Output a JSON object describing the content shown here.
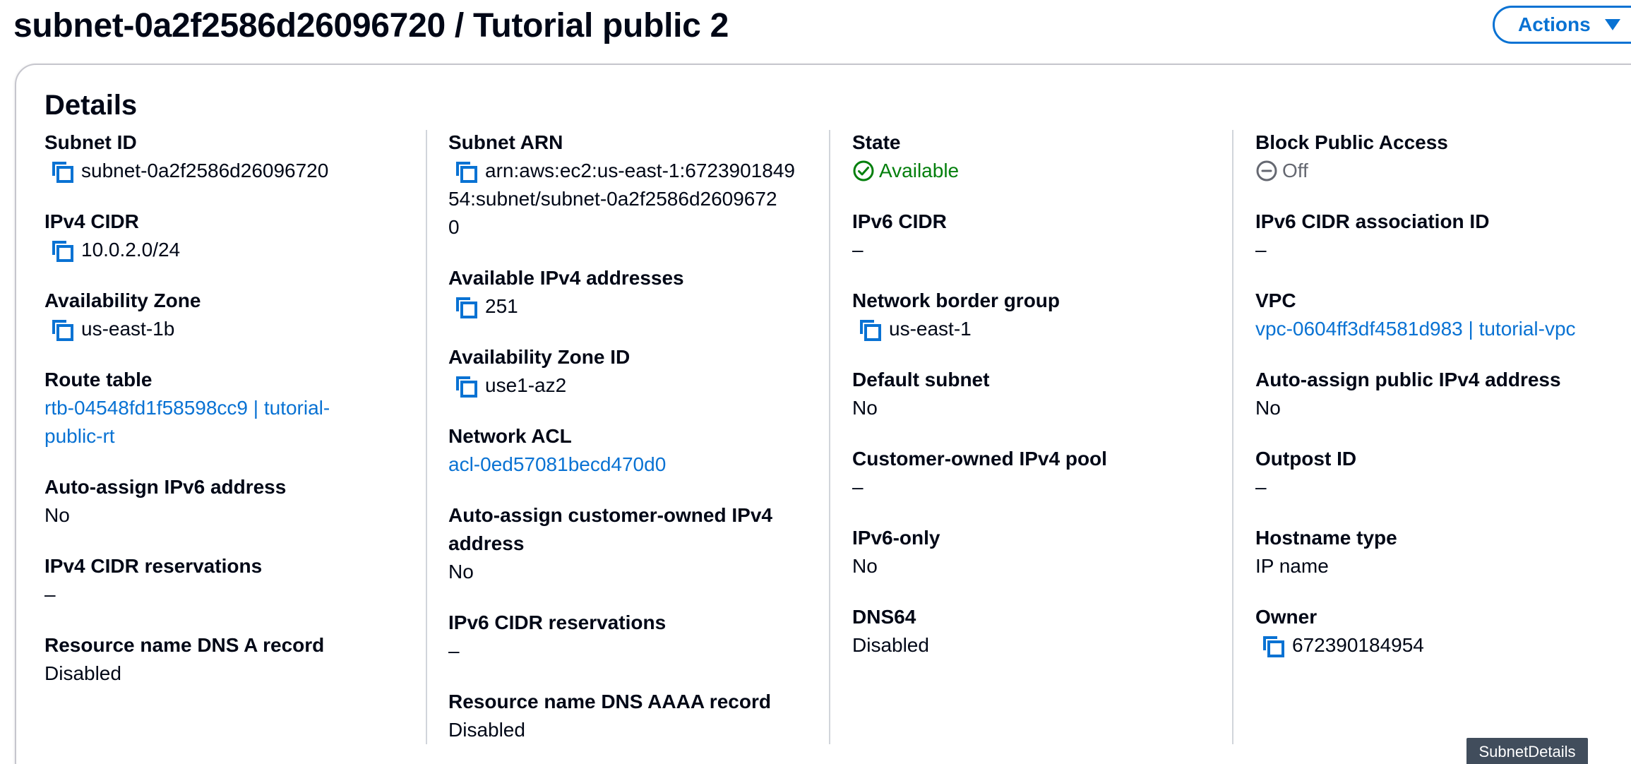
{
  "header": {
    "title": "subnet-0a2f2586d26096720 / Tutorial public 2",
    "actions_label": "Actions"
  },
  "details": {
    "heading": "Details",
    "col1": {
      "subnet_id_label": "Subnet ID",
      "subnet_id_value": "subnet-0a2f2586d26096720",
      "ipv4_cidr_label": "IPv4 CIDR",
      "ipv4_cidr_value": "10.0.2.0/24",
      "az_label": "Availability Zone",
      "az_value": "us-east-1b",
      "route_table_label": "Route table",
      "route_table_line1": "rtb-04548fd1f58598cc9 | tutorial-",
      "route_table_line2": "public-rt",
      "auto_ipv6_label": "Auto-assign IPv6 address",
      "auto_ipv6_value": "No",
      "ipv4_res_label": "IPv4 CIDR reservations",
      "ipv4_res_value": "–",
      "dns_a_label": "Resource name DNS A record",
      "dns_a_value": "Disabled"
    },
    "col2": {
      "arn_label": "Subnet ARN",
      "arn_line1": "arn:aws:ec2:us-east-1:6723901849",
      "arn_line2": "54:subnet/subnet-0a2f2586d2609672",
      "arn_line3": "0",
      "avail_ipv4_label": "Available IPv4 addresses",
      "avail_ipv4_value": "251",
      "az_id_label": "Availability Zone ID",
      "az_id_value": "use1-az2",
      "nacl_label": "Network ACL",
      "nacl_value": "acl-0ed57081becd470d0",
      "auto_cust_label_line1": "Auto-assign customer-owned IPv4",
      "auto_cust_label_line2": "address",
      "auto_cust_value": "No",
      "ipv6_res_label": "IPv6 CIDR reservations",
      "ipv6_res_value": "–",
      "dns_aaaa_label": "Resource name DNS AAAA record",
      "dns_aaaa_value": "Disabled"
    },
    "col3": {
      "state_label": "State",
      "state_value": "Available",
      "ipv6_cidr_label": "IPv6 CIDR",
      "ipv6_cidr_value": "–",
      "nbg_label": "Network border group",
      "nbg_value": "us-east-1",
      "default_label": "Default subnet",
      "default_value": "No",
      "cust_pool_label": "Customer-owned IPv4 pool",
      "cust_pool_value": "–",
      "ipv6_only_label": "IPv6-only",
      "ipv6_only_value": "No",
      "dns64_label": "DNS64",
      "dns64_value": "Disabled"
    },
    "col4": {
      "bpa_label": "Block Public Access",
      "bpa_value": "Off",
      "ipv6_assoc_label": "IPv6 CIDR association ID",
      "ipv6_assoc_value": "–",
      "vpc_label": "VPC",
      "vpc_value": "vpc-0604ff3df4581d983 | tutorial-vpc",
      "auto_pub_label": "Auto-assign public IPv4 address",
      "auto_pub_value": "No",
      "outpost_label": "Outpost ID",
      "outpost_value": "–",
      "hostname_label": "Hostname type",
      "hostname_value": "IP name",
      "owner_label": "Owner",
      "owner_value": "672390184954"
    }
  },
  "tooltip": {
    "text": "SubnetDetails"
  },
  "colors": {
    "link": "#0972d3",
    "success": "#037f0c",
    "muted": "#656871",
    "border": "#c6c6cd",
    "text": "#000716"
  },
  "icons": {
    "copy": "copy-icon",
    "status_available": "check-circle-icon",
    "status_off": "minus-circle-icon",
    "actions_caret": "caret-down-icon"
  }
}
